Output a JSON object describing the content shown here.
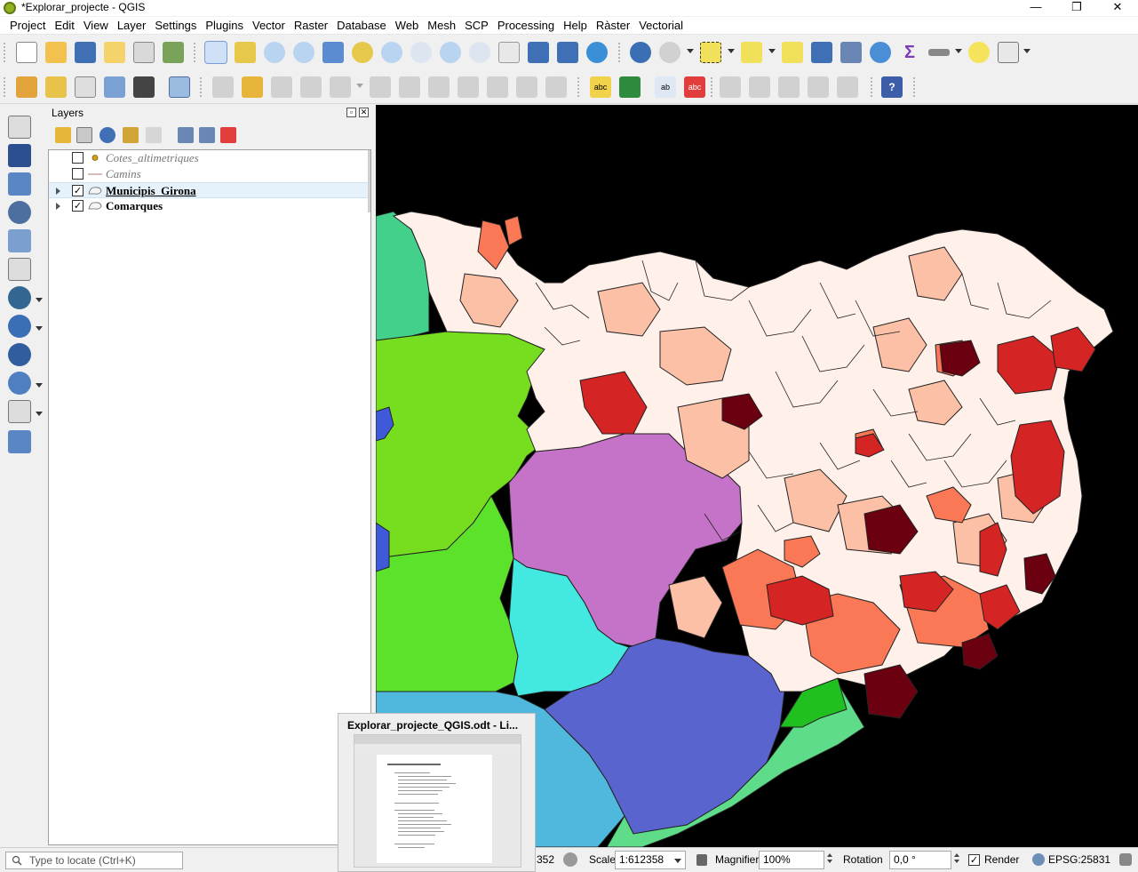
{
  "window": {
    "title": "*Explorar_projecte - QGIS",
    "minimize": "—",
    "restore": "❐",
    "close": "✕"
  },
  "menu": {
    "items": [
      "Project",
      "Edit",
      "View",
      "Layer",
      "Settings",
      "Plugins",
      "Vector",
      "Raster",
      "Database",
      "Web",
      "Mesh",
      "SCP",
      "Processing",
      "Help",
      "Ràster",
      "Vectorial"
    ]
  },
  "layers_panel": {
    "title": "Layers",
    "float_btn": "▫",
    "close_btn": "✕",
    "layers": [
      {
        "name": "Cotes_altimetriques",
        "checked": "",
        "symbol": "point",
        "style": "disabled"
      },
      {
        "name": "Camins",
        "checked": "",
        "symbol": "line",
        "style": "disabled"
      },
      {
        "name": "Municipis_Girona",
        "checked": "✓",
        "symbol": "polygon",
        "style": "selected"
      },
      {
        "name": "Comarques",
        "checked": "✓",
        "symbol": "polygon",
        "style": "bold"
      }
    ]
  },
  "statusbar": {
    "locator_placeholder": "Type to locate (Ctrl+K)",
    "coordinate_partial": "352",
    "scale_label": "Scale",
    "scale_value": "1:612358",
    "magnifier_label": "Magnifier",
    "magnifier_value": "100%",
    "rotation_label": "Rotation",
    "rotation_value": "0,0 °",
    "render_checked": "✓",
    "render_label": "Render",
    "crs": "EPSG:25831"
  },
  "taskbar_preview": {
    "title": "Explorar_projecte_QGIS.odt - Li..."
  },
  "colors": {
    "accent": "#93b023",
    "selection": "#e5f1fb",
    "map_background": "#000000"
  }
}
